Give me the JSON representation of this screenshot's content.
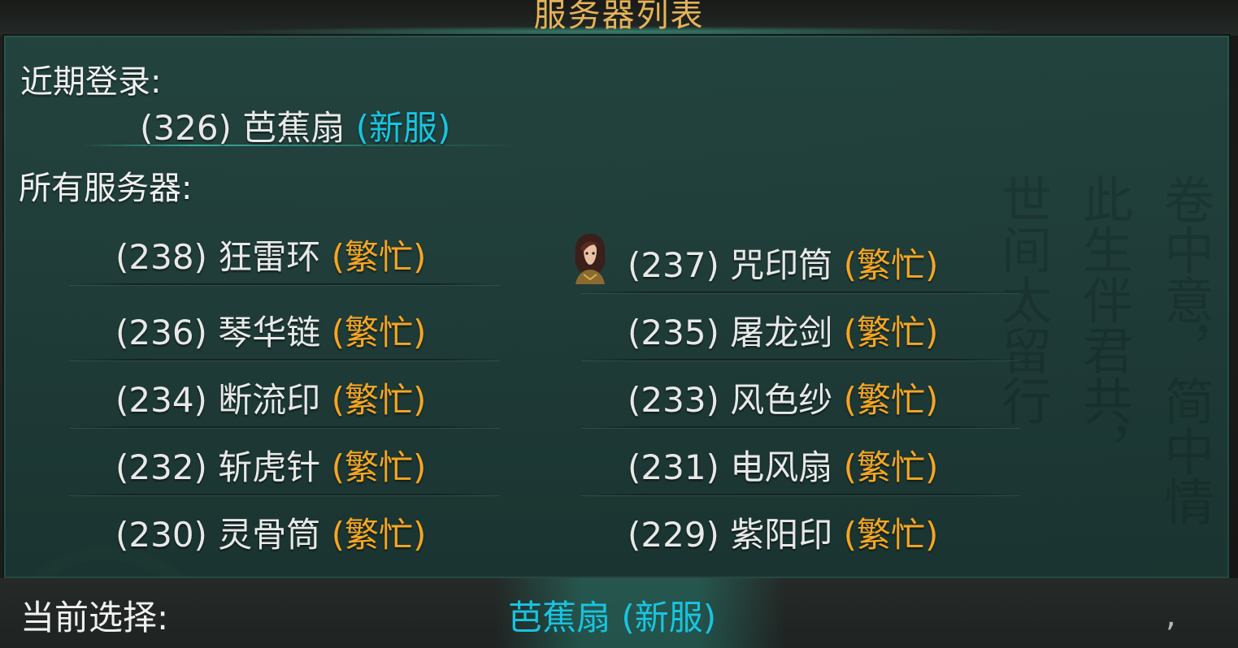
{
  "window": {
    "title": "服务器列表"
  },
  "recent": {
    "label": "近期登录:",
    "server": {
      "num": "(326)",
      "name": "芭蕉扇",
      "status": "(新服)"
    }
  },
  "all": {
    "label": "所有服务器:",
    "servers": [
      {
        "num": "(238)",
        "name": "狂雷环",
        "status": "(繁忙)"
      },
      {
        "num": "(237)",
        "name": "咒印筒",
        "status": "(繁忙)"
      },
      {
        "num": "(236)",
        "name": "琴华链",
        "status": "(繁忙)"
      },
      {
        "num": "(235)",
        "name": "屠龙剑",
        "status": "(繁忙)"
      },
      {
        "num": "(234)",
        "name": "断流印",
        "status": "(繁忙)"
      },
      {
        "num": "(233)",
        "name": "风色纱",
        "status": "(繁忙)"
      },
      {
        "num": "(232)",
        "name": "斩虎针",
        "status": "(繁忙)"
      },
      {
        "num": "(231)",
        "name": "电风扇",
        "status": "(繁忙)"
      },
      {
        "num": "(230)",
        "name": "灵骨筒",
        "status": "(繁忙)"
      },
      {
        "num": "(229)",
        "name": "紫阳印",
        "status": "(繁忙)"
      }
    ]
  },
  "footer": {
    "label": "当前选择:",
    "selected": "芭蕉扇 (新服)",
    "mark": ","
  },
  "background": {
    "calligraphy_columns": [
      "世间太留行",
      "此生伴君共，",
      "卷中意，简中情"
    ]
  },
  "colors": {
    "title": "#e3b35a",
    "busy": "#f5a623",
    "new": "#19c4e0",
    "panel": "#234641",
    "text": "#e8e8e8"
  }
}
